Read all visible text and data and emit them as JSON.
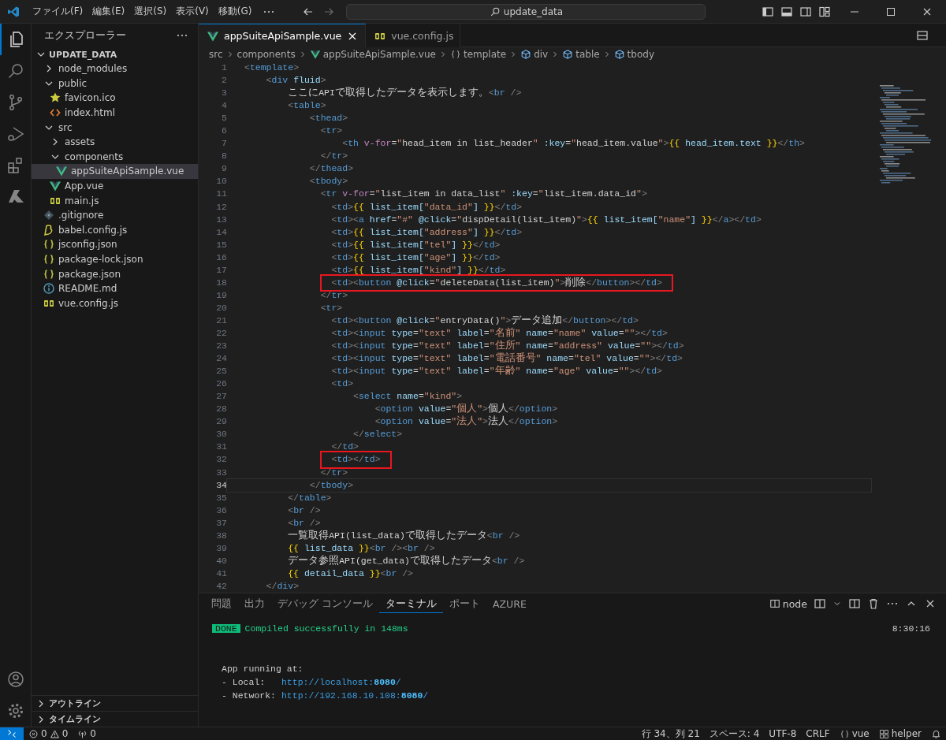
{
  "title_bar": {
    "menus": [
      "ファイル(F)",
      "編集(E)",
      "選択(S)",
      "表示(V)",
      "移動(G)"
    ],
    "search": "update_data"
  },
  "activity_bar": {
    "items": [
      {
        "kind": "files",
        "selected": true
      },
      {
        "kind": "search",
        "selected": false
      },
      {
        "kind": "source-control",
        "selected": false
      },
      {
        "kind": "run",
        "selected": false
      },
      {
        "kind": "extensions",
        "selected": false
      },
      {
        "kind": "azure",
        "selected": false
      }
    ]
  },
  "sidebar": {
    "title": "エクスプローラー",
    "root": {
      "label": "UPDATE_DATA",
      "expanded": true,
      "children": [
        {
          "label": "node_modules",
          "kind": "folder",
          "expanded": false,
          "selected": false
        },
        {
          "label": "public",
          "kind": "folder",
          "expanded": true,
          "selected": false,
          "children": [
            {
              "label": "favicon.ico",
              "kind": "ico",
              "selected": false
            },
            {
              "label": "index.html",
              "kind": "html",
              "selected": false
            }
          ]
        },
        {
          "label": "src",
          "kind": "folder",
          "expanded": true,
          "selected": false,
          "children": [
            {
              "label": "assets",
              "kind": "folder",
              "expanded": false,
              "selected": false
            },
            {
              "label": "components",
              "kind": "folder",
              "expanded": true,
              "selected": false,
              "children": [
                {
                  "label": "appSuiteApiSample.vue",
                  "kind": "vue",
                  "selected": true
                }
              ]
            },
            {
              "label": "App.vue",
              "kind": "vue",
              "selected": false
            },
            {
              "label": "main.js",
              "kind": "js",
              "selected": false
            }
          ]
        },
        {
          "label": ".gitignore",
          "kind": "git",
          "selected": false
        },
        {
          "label": "babel.config.js",
          "kind": "babel",
          "selected": false
        },
        {
          "label": "jsconfig.json",
          "kind": "json",
          "selected": false
        },
        {
          "label": "package-lock.json",
          "kind": "json",
          "selected": false
        },
        {
          "label": "package.json",
          "kind": "json",
          "selected": false
        },
        {
          "label": "README.md",
          "kind": "md",
          "selected": false
        },
        {
          "label": "vue.config.js",
          "kind": "js",
          "selected": false
        }
      ]
    },
    "sections": [
      {
        "label": "アウトライン",
        "expanded": false
      },
      {
        "label": "タイムライン",
        "expanded": false
      }
    ]
  },
  "editor": {
    "tabs": [
      {
        "label": "appSuiteApiSample.vue",
        "kind": "vue",
        "selected": true
      },
      {
        "label": "vue.config.js",
        "kind": "js",
        "selected": false
      }
    ],
    "breadcrumb": [
      {
        "label": "src",
        "kind": "folder"
      },
      {
        "label": "components",
        "kind": "folder"
      },
      {
        "label": "appSuiteApiSample.vue",
        "kind": "vue"
      },
      {
        "label": "template",
        "kind": "namespace"
      },
      {
        "label": "div",
        "kind": "element"
      },
      {
        "label": "table",
        "kind": "element"
      },
      {
        "label": "tbody",
        "kind": "element"
      }
    ],
    "lines": [
      {
        "number": "1",
        "current": false,
        "highlighted": false,
        "tokens": [
          {
            "kind": "tag",
            "text": "<template>"
          }
        ]
      },
      {
        "number": "2",
        "current": false,
        "highlighted": false,
        "tokens": [
          {
            "kind": "tag",
            "text": "    <div"
          },
          {
            "kind": "attr",
            "text": " fluid"
          },
          {
            "kind": "tag",
            "text": ">"
          }
        ]
      },
      {
        "number": "3",
        "current": false,
        "highlighted": false,
        "tokens": [
          {
            "kind": "text",
            "text": "        ここにAPIで取得したデータを表示します。"
          },
          {
            "kind": "tag",
            "text": "<br />"
          }
        ]
      },
      {
        "number": "4",
        "current": false,
        "highlighted": false,
        "tokens": [
          {
            "kind": "tag",
            "text": "        <table>"
          }
        ]
      },
      {
        "number": "5",
        "current": false,
        "highlighted": false,
        "tokens": [
          {
            "kind": "tag",
            "text": "            <thead>"
          }
        ]
      },
      {
        "number": "6",
        "current": false,
        "highlighted": false,
        "tokens": [
          {
            "kind": "tag",
            "text": "              <tr>"
          }
        ]
      },
      {
        "number": "7",
        "current": false,
        "highlighted": false,
        "tokens": [
          {
            "kind": "tag",
            "text": "                  <th"
          },
          {
            "kind": "directive",
            "text": " v-for"
          },
          {
            "kind": "text",
            "text": "="
          },
          {
            "kind": "js",
            "text": "\"head_item in list_header\""
          },
          {
            "kind": "attr",
            "text": " :key"
          },
          {
            "kind": "text",
            "text": "="
          },
          {
            "kind": "js",
            "text": "\"head_item.value\""
          },
          {
            "kind": "tag",
            "text": ">"
          },
          {
            "kind": "brace",
            "text": "{{"
          },
          {
            "kind": "var",
            "text": " head_item.text "
          },
          {
            "kind": "brace",
            "text": "}}"
          },
          {
            "kind": "tag",
            "text": "</th>"
          }
        ]
      },
      {
        "number": "8",
        "current": false,
        "highlighted": false,
        "tokens": [
          {
            "kind": "tag",
            "text": "              </tr>"
          }
        ]
      },
      {
        "number": "9",
        "current": false,
        "highlighted": false,
        "tokens": [
          {
            "kind": "tag",
            "text": "            </thead>"
          }
        ]
      },
      {
        "number": "10",
        "current": false,
        "highlighted": false,
        "tokens": [
          {
            "kind": "tag",
            "text": "            <tbody>"
          }
        ]
      },
      {
        "number": "11",
        "current": false,
        "highlighted": false,
        "tokens": [
          {
            "kind": "tag",
            "text": "              <tr"
          },
          {
            "kind": "directive",
            "text": " v-for"
          },
          {
            "kind": "text",
            "text": "="
          },
          {
            "kind": "js",
            "text": "\"list_item in data_list\""
          },
          {
            "kind": "attr",
            "text": " :key"
          },
          {
            "kind": "text",
            "text": "="
          },
          {
            "kind": "js",
            "text": "\"list_item.data_id\""
          },
          {
            "kind": "tag",
            "text": ">"
          }
        ]
      },
      {
        "number": "12",
        "current": false,
        "highlighted": false,
        "tokens": [
          {
            "kind": "tag",
            "text": "                <td>"
          },
          {
            "kind": "brace",
            "text": "{{"
          },
          {
            "kind": "var",
            "text": " list_item["
          },
          {
            "kind": "str",
            "text": "\"data_id\""
          },
          {
            "kind": "var",
            "text": "] "
          },
          {
            "kind": "brace",
            "text": "}}"
          },
          {
            "kind": "tag",
            "text": "</td>"
          }
        ]
      },
      {
        "number": "13",
        "current": false,
        "highlighted": false,
        "tokens": [
          {
            "kind": "tag",
            "text": "                <td><a"
          },
          {
            "kind": "attr",
            "text": " href"
          },
          {
            "kind": "text",
            "text": "="
          },
          {
            "kind": "str",
            "text": "\"#\""
          },
          {
            "kind": "attr",
            "text": " @click"
          },
          {
            "kind": "text",
            "text": "="
          },
          {
            "kind": "js",
            "text": "\"dispDetail(list_item)\""
          },
          {
            "kind": "tag",
            "text": ">"
          },
          {
            "kind": "brace",
            "text": "{{"
          },
          {
            "kind": "var",
            "text": " list_item["
          },
          {
            "kind": "str",
            "text": "\"name\""
          },
          {
            "kind": "var",
            "text": "] "
          },
          {
            "kind": "brace",
            "text": "}}"
          },
          {
            "kind": "tag",
            "text": "</a></td>"
          }
        ]
      },
      {
        "number": "14",
        "current": false,
        "highlighted": false,
        "tokens": [
          {
            "kind": "tag",
            "text": "                <td>"
          },
          {
            "kind": "brace",
            "text": "{{"
          },
          {
            "kind": "var",
            "text": " list_item["
          },
          {
            "kind": "str",
            "text": "\"address\""
          },
          {
            "kind": "var",
            "text": "] "
          },
          {
            "kind": "brace",
            "text": "}}"
          },
          {
            "kind": "tag",
            "text": "</td>"
          }
        ]
      },
      {
        "number": "15",
        "current": false,
        "highlighted": false,
        "tokens": [
          {
            "kind": "tag",
            "text": "                <td>"
          },
          {
            "kind": "brace",
            "text": "{{"
          },
          {
            "kind": "var",
            "text": " list_item["
          },
          {
            "kind": "str",
            "text": "\"tel\""
          },
          {
            "kind": "var",
            "text": "] "
          },
          {
            "kind": "brace",
            "text": "}}"
          },
          {
            "kind": "tag",
            "text": "</td>"
          }
        ]
      },
      {
        "number": "16",
        "current": false,
        "highlighted": false,
        "tokens": [
          {
            "kind": "tag",
            "text": "                <td>"
          },
          {
            "kind": "brace",
            "text": "{{"
          },
          {
            "kind": "var",
            "text": " list_item["
          },
          {
            "kind": "str",
            "text": "\"age\""
          },
          {
            "kind": "var",
            "text": "] "
          },
          {
            "kind": "brace",
            "text": "}}"
          },
          {
            "kind": "tag",
            "text": "</td>"
          }
        ]
      },
      {
        "number": "17",
        "current": false,
        "highlighted": false,
        "tokens": [
          {
            "kind": "tag",
            "text": "                <td>"
          },
          {
            "kind": "brace",
            "text": "{{"
          },
          {
            "kind": "var",
            "text": " list_item["
          },
          {
            "kind": "str",
            "text": "\"kind\""
          },
          {
            "kind": "var",
            "text": "] "
          },
          {
            "kind": "brace",
            "text": "}}"
          },
          {
            "kind": "tag",
            "text": "</td>"
          }
        ]
      },
      {
        "number": "18",
        "current": false,
        "highlighted": true,
        "tokens": [
          {
            "kind": "tag",
            "text": "                <td><button"
          },
          {
            "kind": "attr",
            "text": " @click"
          },
          {
            "kind": "text",
            "text": "="
          },
          {
            "kind": "js",
            "text": "\"deleteData(list_item)\""
          },
          {
            "kind": "tag",
            "text": ">"
          },
          {
            "kind": "text",
            "text": "削除"
          },
          {
            "kind": "tag",
            "text": "</button></td>"
          }
        ]
      },
      {
        "number": "19",
        "current": false,
        "highlighted": false,
        "tokens": [
          {
            "kind": "tag",
            "text": "              </tr>"
          }
        ]
      },
      {
        "number": "20",
        "current": false,
        "highlighted": false,
        "tokens": [
          {
            "kind": "tag",
            "text": "              <tr>"
          }
        ]
      },
      {
        "number": "21",
        "current": false,
        "highlighted": false,
        "tokens": [
          {
            "kind": "tag",
            "text": "                <td><button"
          },
          {
            "kind": "attr",
            "text": " @click"
          },
          {
            "kind": "text",
            "text": "="
          },
          {
            "kind": "js",
            "text": "\"entryData()\""
          },
          {
            "kind": "tag",
            "text": ">"
          },
          {
            "kind": "text",
            "text": "データ追加"
          },
          {
            "kind": "tag",
            "text": "</button></td>"
          }
        ]
      },
      {
        "number": "22",
        "current": false,
        "highlighted": false,
        "tokens": [
          {
            "kind": "tag",
            "text": "                <td><input"
          },
          {
            "kind": "attr",
            "text": " type"
          },
          {
            "kind": "text",
            "text": "="
          },
          {
            "kind": "str",
            "text": "\"text\""
          },
          {
            "kind": "attr",
            "text": " label"
          },
          {
            "kind": "text",
            "text": "="
          },
          {
            "kind": "str",
            "text": "\"名前\""
          },
          {
            "kind": "attr",
            "text": " name"
          },
          {
            "kind": "text",
            "text": "="
          },
          {
            "kind": "str",
            "text": "\"name\""
          },
          {
            "kind": "attr",
            "text": " value"
          },
          {
            "kind": "text",
            "text": "="
          },
          {
            "kind": "str",
            "text": "\"\""
          },
          {
            "kind": "tag",
            "text": "></td>"
          }
        ]
      },
      {
        "number": "23",
        "current": false,
        "highlighted": false,
        "tokens": [
          {
            "kind": "tag",
            "text": "                <td><input"
          },
          {
            "kind": "attr",
            "text": " type"
          },
          {
            "kind": "text",
            "text": "="
          },
          {
            "kind": "str",
            "text": "\"text\""
          },
          {
            "kind": "attr",
            "text": " label"
          },
          {
            "kind": "text",
            "text": "="
          },
          {
            "kind": "str",
            "text": "\"住所\""
          },
          {
            "kind": "attr",
            "text": " name"
          },
          {
            "kind": "text",
            "text": "="
          },
          {
            "kind": "str",
            "text": "\"address\""
          },
          {
            "kind": "attr",
            "text": " value"
          },
          {
            "kind": "text",
            "text": "="
          },
          {
            "kind": "str",
            "text": "\"\""
          },
          {
            "kind": "tag",
            "text": "></td>"
          }
        ]
      },
      {
        "number": "24",
        "current": false,
        "highlighted": false,
        "tokens": [
          {
            "kind": "tag",
            "text": "                <td><input"
          },
          {
            "kind": "attr",
            "text": " type"
          },
          {
            "kind": "text",
            "text": "="
          },
          {
            "kind": "str",
            "text": "\"text\""
          },
          {
            "kind": "attr",
            "text": " label"
          },
          {
            "kind": "text",
            "text": "="
          },
          {
            "kind": "str",
            "text": "\"電話番号\""
          },
          {
            "kind": "attr",
            "text": " name"
          },
          {
            "kind": "text",
            "text": "="
          },
          {
            "kind": "str",
            "text": "\"tel\""
          },
          {
            "kind": "attr",
            "text": " value"
          },
          {
            "kind": "text",
            "text": "="
          },
          {
            "kind": "str",
            "text": "\"\""
          },
          {
            "kind": "tag",
            "text": "></td>"
          }
        ]
      },
      {
        "number": "25",
        "current": false,
        "highlighted": false,
        "tokens": [
          {
            "kind": "tag",
            "text": "                <td><input"
          },
          {
            "kind": "attr",
            "text": " type"
          },
          {
            "kind": "text",
            "text": "="
          },
          {
            "kind": "str",
            "text": "\"text\""
          },
          {
            "kind": "attr",
            "text": " label"
          },
          {
            "kind": "text",
            "text": "="
          },
          {
            "kind": "str",
            "text": "\"年齢\""
          },
          {
            "kind": "attr",
            "text": " name"
          },
          {
            "kind": "text",
            "text": "="
          },
          {
            "kind": "str",
            "text": "\"age\""
          },
          {
            "kind": "attr",
            "text": " value"
          },
          {
            "kind": "text",
            "text": "="
          },
          {
            "kind": "str",
            "text": "\"\""
          },
          {
            "kind": "tag",
            "text": "></td>"
          }
        ]
      },
      {
        "number": "26",
        "current": false,
        "highlighted": false,
        "tokens": [
          {
            "kind": "tag",
            "text": "                <td>"
          }
        ]
      },
      {
        "number": "27",
        "current": false,
        "highlighted": false,
        "tokens": [
          {
            "kind": "tag",
            "text": "                    <select"
          },
          {
            "kind": "attr",
            "text": " name"
          },
          {
            "kind": "text",
            "text": "="
          },
          {
            "kind": "str",
            "text": "\"kind\""
          },
          {
            "kind": "tag",
            "text": ">"
          }
        ]
      },
      {
        "number": "28",
        "current": false,
        "highlighted": false,
        "tokens": [
          {
            "kind": "tag",
            "text": "                        <option"
          },
          {
            "kind": "attr",
            "text": " value"
          },
          {
            "kind": "text",
            "text": "="
          },
          {
            "kind": "str",
            "text": "\"個人\""
          },
          {
            "kind": "tag",
            "text": ">"
          },
          {
            "kind": "text",
            "text": "個人"
          },
          {
            "kind": "tag",
            "text": "</option>"
          }
        ]
      },
      {
        "number": "29",
        "current": false,
        "highlighted": false,
        "tokens": [
          {
            "kind": "tag",
            "text": "                        <option"
          },
          {
            "kind": "attr",
            "text": " value"
          },
          {
            "kind": "text",
            "text": "="
          },
          {
            "kind": "str",
            "text": "\"法人\""
          },
          {
            "kind": "tag",
            "text": ">"
          },
          {
            "kind": "text",
            "text": "法人"
          },
          {
            "kind": "tag",
            "text": "</option>"
          }
        ]
      },
      {
        "number": "30",
        "current": false,
        "highlighted": false,
        "tokens": [
          {
            "kind": "tag",
            "text": "                    </select>"
          }
        ]
      },
      {
        "number": "31",
        "current": false,
        "highlighted": false,
        "tokens": [
          {
            "kind": "tag",
            "text": "                </td>"
          }
        ]
      },
      {
        "number": "32",
        "current": false,
        "highlighted": true,
        "tokens": [
          {
            "kind": "tag",
            "text": "                <td></td>"
          }
        ]
      },
      {
        "number": "33",
        "current": false,
        "highlighted": false,
        "tokens": [
          {
            "kind": "tag",
            "text": "              </tr>"
          }
        ]
      },
      {
        "number": "34",
        "current": true,
        "highlighted": false,
        "tokens": [
          {
            "kind": "tag",
            "text": "            </tbody>"
          }
        ]
      },
      {
        "number": "35",
        "current": false,
        "highlighted": false,
        "tokens": [
          {
            "kind": "tag",
            "text": "        </table>"
          }
        ]
      },
      {
        "number": "36",
        "current": false,
        "highlighted": false,
        "tokens": [
          {
            "kind": "tag",
            "text": "        <br />"
          }
        ]
      },
      {
        "number": "37",
        "current": false,
        "highlighted": false,
        "tokens": [
          {
            "kind": "tag",
            "text": "        <br />"
          }
        ]
      },
      {
        "number": "38",
        "current": false,
        "highlighted": false,
        "tokens": [
          {
            "kind": "text",
            "text": "        一覧取得API(list_data)で取得したデータ"
          },
          {
            "kind": "tag",
            "text": "<br />"
          }
        ]
      },
      {
        "number": "39",
        "current": false,
        "highlighted": false,
        "tokens": [
          {
            "kind": "brace",
            "text": "        {{"
          },
          {
            "kind": "var",
            "text": " list_data "
          },
          {
            "kind": "brace",
            "text": "}}"
          },
          {
            "kind": "tag",
            "text": "<br />"
          },
          {
            "kind": "tag",
            "text": "<br />"
          }
        ]
      },
      {
        "number": "40",
        "current": false,
        "highlighted": false,
        "tokens": [
          {
            "kind": "text",
            "text": "        データ参照API(get_data)で取得したデータ"
          },
          {
            "kind": "tag",
            "text": "<br />"
          }
        ]
      },
      {
        "number": "41",
        "current": false,
        "highlighted": false,
        "tokens": [
          {
            "kind": "brace",
            "text": "        {{"
          },
          {
            "kind": "var",
            "text": " detail_data "
          },
          {
            "kind": "brace",
            "text": "}}"
          },
          {
            "kind": "tag",
            "text": "<br />"
          }
        ]
      },
      {
        "number": "42",
        "current": false,
        "highlighted": false,
        "tokens": [
          {
            "kind": "tag",
            "text": "    </div>"
          }
        ]
      }
    ]
  },
  "panel": {
    "tabs": [
      {
        "label": "問題",
        "selected": false
      },
      {
        "label": "出力",
        "selected": false
      },
      {
        "label": "デバッグ コンソール",
        "selected": false
      },
      {
        "label": "ターミナル",
        "selected": true
      },
      {
        "label": "ポート",
        "selected": false
      },
      {
        "label": "AZURE",
        "selected": false
      }
    ],
    "terminal_name": "node",
    "terminal": {
      "badge": "DONE",
      "message": "Compiled successfully in 148ms",
      "time": "8:30:16",
      "heading": "App running at:",
      "lines": [
        {
          "label": "- Local:   ",
          "link": "http://localhost:**8080**/"
        },
        {
          "label": "- Network: ",
          "link": "http://192.168.10.108:**8080**/"
        }
      ]
    }
  },
  "status_bar": {
    "errors": "0",
    "warnings": "0",
    "ports": "0",
    "items": [
      "行 34、列 21",
      "スペース: 4",
      "UTF-8",
      "CRLF"
    ],
    "language": "vue",
    "profile": "helper"
  }
}
